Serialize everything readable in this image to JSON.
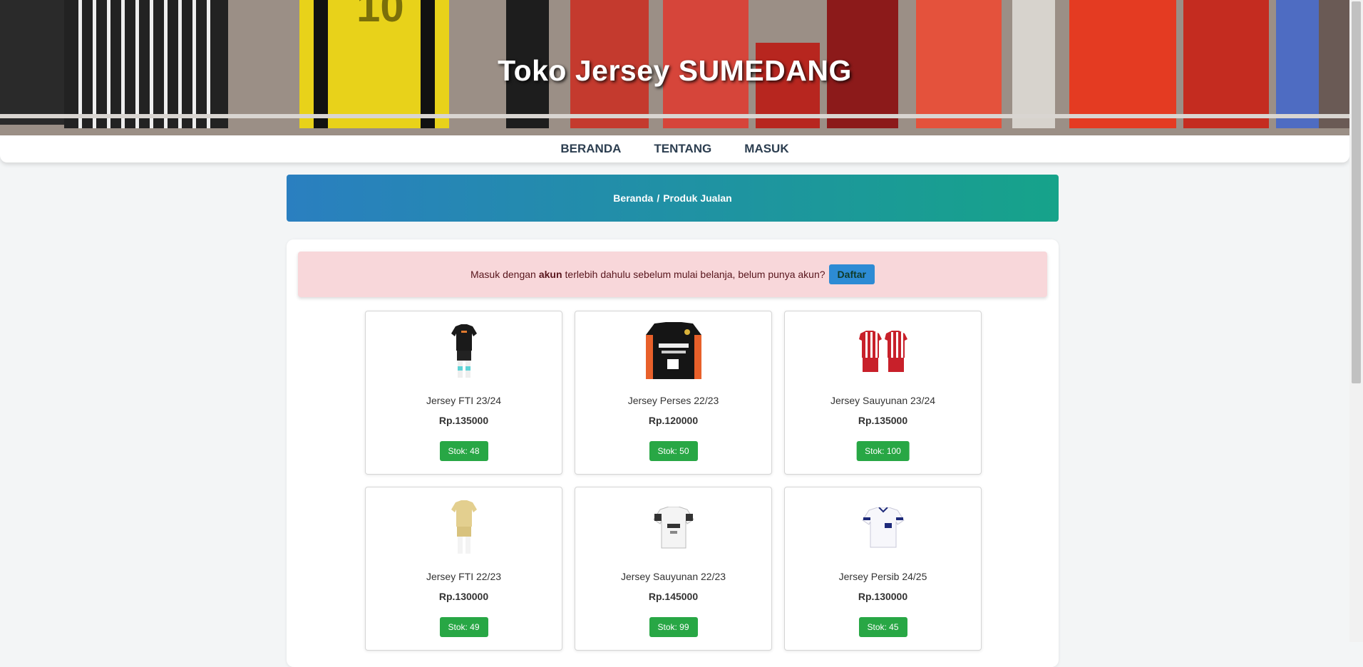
{
  "header": {
    "title": "Toko Jersey SUMEDANG"
  },
  "nav": {
    "items": [
      "BERANDA",
      "TENTANG",
      "MASUK"
    ]
  },
  "breadcrumb": {
    "home": "Beranda",
    "separator": "/",
    "current": "Produk Jualan"
  },
  "alert": {
    "text_before": "Masuk dengan",
    "bold": "akun",
    "text_after": "terlebih dahulu sebelum mulai belanja, belum punya akun?",
    "button": "Daftar"
  },
  "products": [
    {
      "name": "Jersey FTI 23/24",
      "price": "Rp.135000",
      "stock": "Stok: 48",
      "icon": "black-kit-icon"
    },
    {
      "name": "Jersey Perses 22/23",
      "price": "Rp.120000",
      "stock": "Stok: 50",
      "icon": "black-orange-shirt-icon"
    },
    {
      "name": "Jersey Sauyunan 23/24",
      "price": "Rp.135000",
      "stock": "Stok: 100",
      "icon": "red-white-kit-icon"
    },
    {
      "name": "Jersey FTI 22/23",
      "price": "Rp.130000",
      "stock": "Stok: 49",
      "icon": "gold-kit-icon"
    },
    {
      "name": "Jersey Sauyunan 22/23",
      "price": "Rp.145000",
      "stock": "Stok: 99",
      "icon": "white-shirt-icon"
    },
    {
      "name": "Jersey Persib 24/25",
      "price": "Rp.130000",
      "stock": "Stok: 45",
      "icon": "white-blue-shirt-icon"
    }
  ],
  "colors": {
    "accent": "#2a7fc0",
    "success": "#28a745",
    "alert_bg": "#f8d7da"
  }
}
